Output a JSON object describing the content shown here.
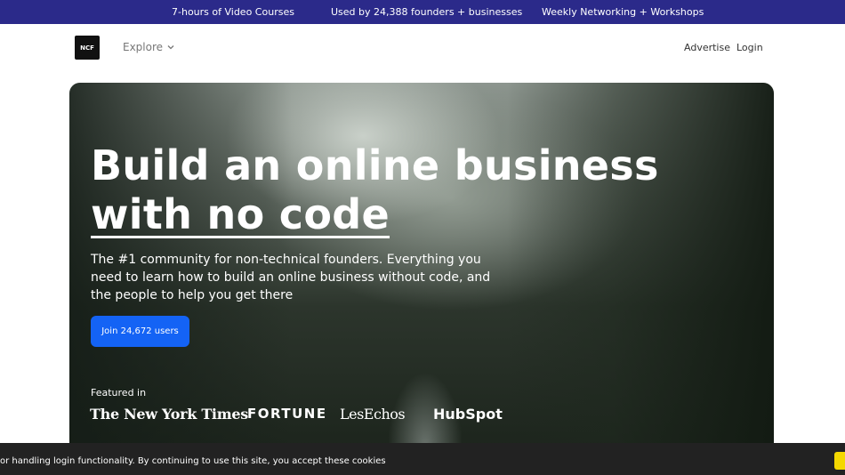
{
  "announcement": {
    "item1": "7-hours of Video Courses",
    "item2": "Used by 24,388 founders + businesses",
    "item3": "Weekly Networking + Workshops"
  },
  "nav": {
    "logo": "NCF",
    "explore": "Explore",
    "advertise": "Advertise",
    "login": "Login"
  },
  "hero": {
    "headline_line1": "Build an online business",
    "headline_line2": "with no code",
    "subtext": "The #1 community for non-technical founders. Everything you need to learn how to build an online business without code, and the people to help you get there",
    "cta": "Join 24,672 users",
    "featured_label": "Featured in",
    "press": [
      "The New York Times",
      "FORTUNE",
      "LesEchos",
      "HubSpot"
    ]
  },
  "cookie_banner": {
    "text": "or handling login functionality. By continuing to use this site, you accept these cookies"
  },
  "colors": {
    "announcement_bg": "#2b2a8a",
    "cta_bg": "#1463f5",
    "cookie_bg": "#222222",
    "cookie_button": "#f4d800"
  }
}
